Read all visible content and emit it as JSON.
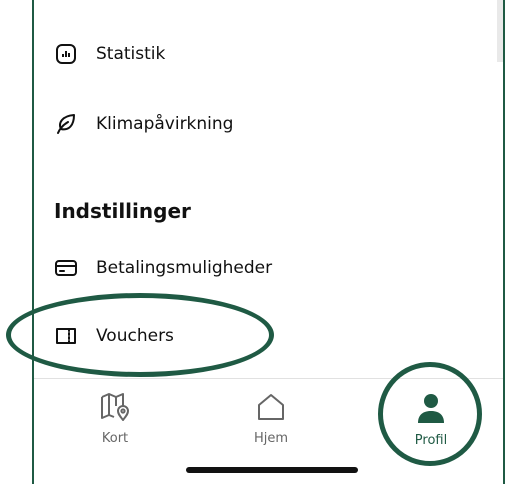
{
  "menu": {
    "items": [
      {
        "label": "Statistik",
        "icon": "bar-chart-icon"
      },
      {
        "label": "Klimapåvirkning",
        "icon": "leaf-icon"
      }
    ]
  },
  "settings": {
    "title": "Indstillinger",
    "items": [
      {
        "label": "Betalingsmuligheder",
        "icon": "credit-card-icon"
      },
      {
        "label": "Vouchers",
        "icon": "voucher-icon"
      }
    ]
  },
  "bottom_nav": {
    "items": [
      {
        "label": "Kort",
        "icon": "map-pin-icon",
        "active": false
      },
      {
        "label": "Hjem",
        "icon": "home-icon",
        "active": false
      },
      {
        "label": "Profil",
        "icon": "person-icon",
        "active": true
      }
    ]
  },
  "colors": {
    "accent": "#1f5a44",
    "inactive": "#666666",
    "text": "#111111"
  }
}
